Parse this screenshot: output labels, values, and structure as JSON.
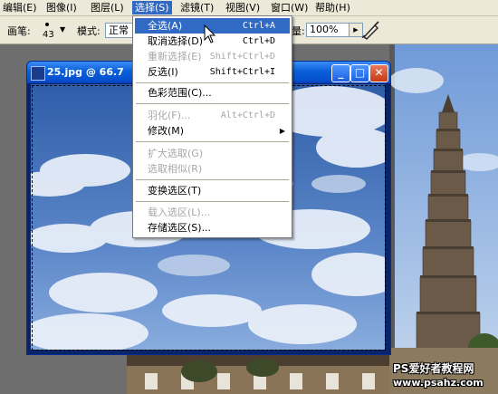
{
  "menubar": {
    "items": [
      {
        "label": "编辑(E)"
      },
      {
        "label": "图像(I)"
      },
      {
        "label": "图层(L)"
      },
      {
        "label": "选择(S)"
      },
      {
        "label": "滤镜(T)"
      },
      {
        "label": "视图(V)"
      },
      {
        "label": "窗口(W)"
      },
      {
        "label": "帮助(H)"
      }
    ]
  },
  "options": {
    "brush_label": "画笔:",
    "brush_size": "43",
    "mode_label": "模式:",
    "mode_value": "正常",
    "flow_label": "量:",
    "zoom_value": "100%"
  },
  "document": {
    "title": "25.jpg @ 66.7"
  },
  "select_menu": {
    "items": [
      {
        "label": "全选(A)",
        "shortcut": "Ctrl+A"
      },
      {
        "label": "取消选择(D)",
        "shortcut": "Ctrl+D"
      },
      {
        "label": "重新选择(E)",
        "shortcut": "Shift+Ctrl+D"
      },
      {
        "label": "反选(I)",
        "shortcut": "Shift+Ctrl+I"
      },
      {
        "label": "色彩范围(C)..."
      },
      {
        "label": "羽化(F)...",
        "shortcut": "Alt+Ctrl+D"
      },
      {
        "label": "修改(M)"
      },
      {
        "label": "扩大选取(G)"
      },
      {
        "label": "选取相似(R)"
      },
      {
        "label": "变换选区(T)"
      },
      {
        "label": "载入选区(L)..."
      },
      {
        "label": "存储选区(S)..."
      }
    ]
  },
  "watermark": {
    "line1": "PS爱好者教程网",
    "line2": "www.psahz.com"
  },
  "colors": {
    "highlight": "#316ac5",
    "menubar_bg": "#ece9d8",
    "disabled_text": "#a7a6aa",
    "titlebar_blue": "#0a5fd8"
  }
}
